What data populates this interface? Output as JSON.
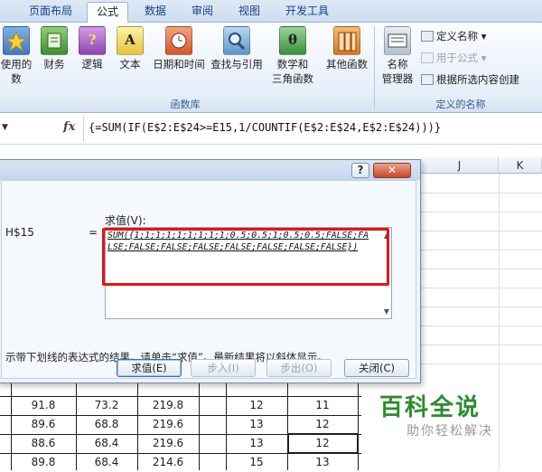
{
  "ribbon_tabs": [
    "页面布局",
    "公式",
    "数据",
    "审阅",
    "视图",
    "开发工具"
  ],
  "ribbon": {
    "function_library": {
      "buttons": [
        {
          "label": "使用的",
          "label2": "数",
          "icon": "star-book-icon"
        },
        {
          "label": "财务",
          "label2": "",
          "icon": "finance-book-icon"
        },
        {
          "label": "逻辑",
          "label2": "",
          "icon": "logic-book-icon"
        },
        {
          "label": "文本",
          "label2": "",
          "icon": "text-book-icon"
        },
        {
          "label": "日期和时间",
          "label2": "",
          "icon": "datetime-book-icon"
        },
        {
          "label": "查找与引用",
          "label2": "",
          "icon": "lookup-book-icon"
        },
        {
          "label": "数学和",
          "label2": "三角函数",
          "icon": "math-book-icon"
        },
        {
          "label": "其他函数",
          "label2": "",
          "icon": "more-books-icon"
        }
      ],
      "glyphs": {
        "logic": "?",
        "text": "A",
        "math": "θ"
      },
      "group_label": "函数库"
    },
    "defined_names": {
      "name_manager": {
        "label": "名称",
        "label2": "管理器"
      },
      "define_name": "定义名称",
      "use_in_formula": "用于公式",
      "create_from_selection": "根据所选内容创建",
      "group_label": "定义的名称"
    }
  },
  "formula_bar": {
    "fx": "fx",
    "formula": "{=SUM(IF(E$2:E$24>=E15,1/COUNTIF(E$2:E$24,E$2:E$24)))}"
  },
  "columns": [
    "J",
    "K"
  ],
  "dialog": {
    "reference": "H$15",
    "equals": "=",
    "evaluation_label": "求值(V):",
    "evaluation": "SUM({1;1;1;1;1;1;1;1;1;0.5;0.5;1;0.5;0.5;FALSE;FALSE;FALSE;FALSE;FALSE;FALSE;FALSE;FALSE;FALSE})",
    "note": "示带下划线的表达式的结果，请单击“求值”。最新结果将以斜体显示。",
    "buttons": {
      "evaluate": "求值(E)",
      "step_in": "步入(I)",
      "step_out": "步出(O)",
      "close": "关闭(C)"
    }
  },
  "table_rows": [
    {
      "c1": "91.8",
      "c2": "73.2",
      "c3": "219.8",
      "c4": "12",
      "c5": "11"
    },
    {
      "c1": "89.6",
      "c2": "68.8",
      "c3": "219.6",
      "c4": "13",
      "c5": "12"
    },
    {
      "c1": "88.6",
      "c2": "68.4",
      "c3": "219.6",
      "c4": "13",
      "c5": "12"
    },
    {
      "c1": "89.8",
      "c2": "68.4",
      "c3": "214.6",
      "c4": "15",
      "c5": "13"
    }
  ],
  "watermark": {
    "title": "百科全说",
    "subtitle": "助你轻松解决"
  }
}
